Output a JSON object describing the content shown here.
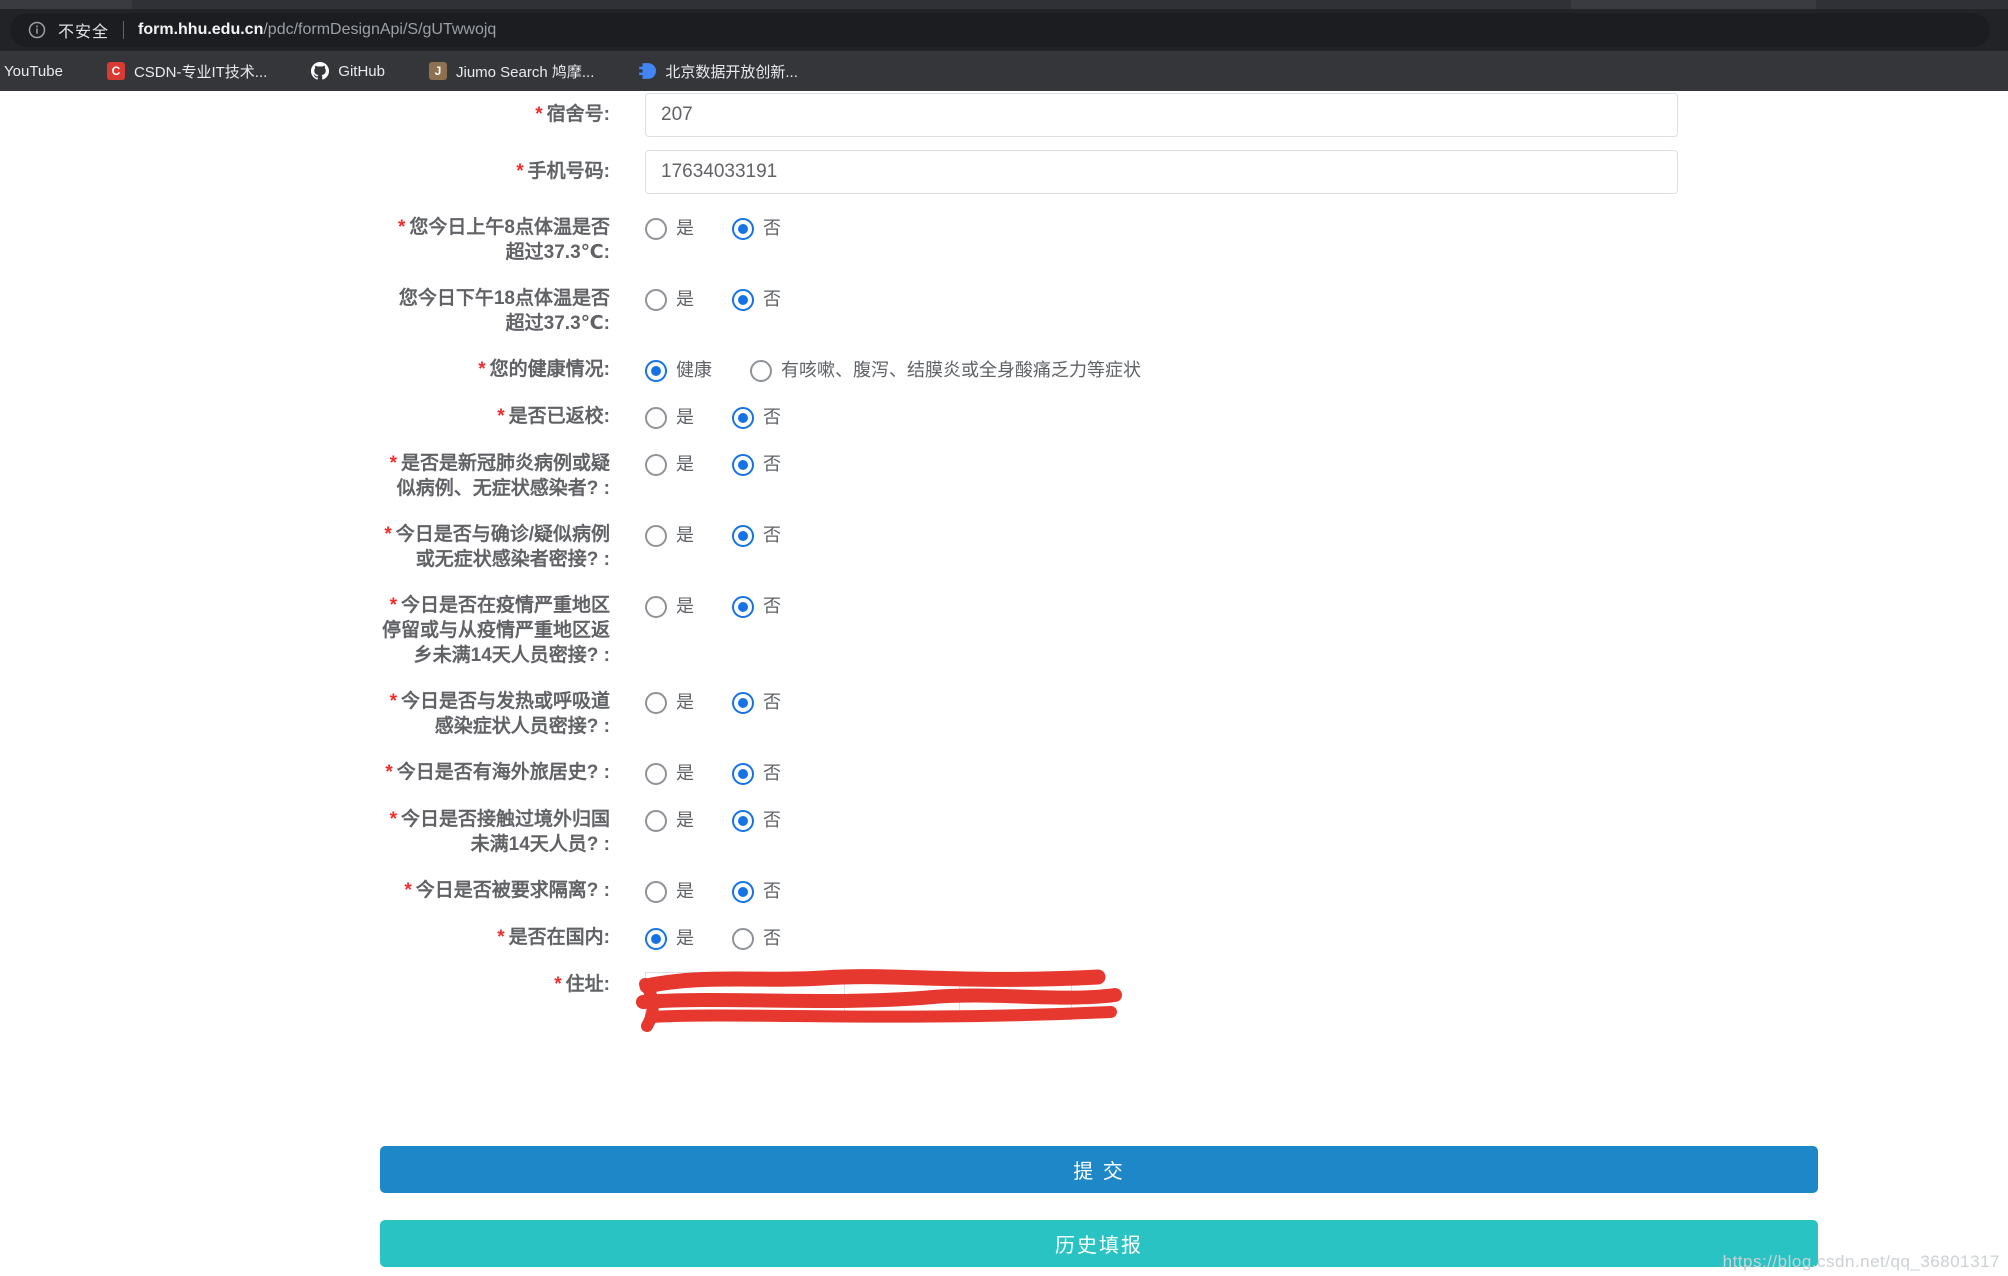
{
  "browser": {
    "security_label": "不安全",
    "url_domain": "form.hhu.edu.cn",
    "url_path": "/pdc/formDesignApi/S/gUTwwojq",
    "bookmarks": [
      {
        "label": "YouTube",
        "icon": "none"
      },
      {
        "label": "CSDN-专业IT技术...",
        "icon": "csdn-icon",
        "icon_letter": "C",
        "icon_color": "#d93a31"
      },
      {
        "label": "GitHub",
        "icon": "github-icon"
      },
      {
        "label": "Jiumo Search 鸠摩...",
        "icon": "jiumo-icon",
        "icon_letter": "J",
        "icon_color": "#8d7150"
      },
      {
        "label": "北京数据开放创新...",
        "icon": "beijing-data-icon",
        "icon_color": "#4285f4"
      }
    ]
  },
  "form": {
    "required_marker": "*",
    "fields": [
      {
        "type": "text",
        "required": true,
        "label": "宿舍号:",
        "value": "207"
      },
      {
        "type": "text",
        "required": true,
        "label": "手机号码:",
        "value": "17634033191"
      },
      {
        "type": "radio",
        "required": true,
        "label": "您今日上午8点体温是否超过37.3℃:",
        "options": [
          "是",
          "否"
        ],
        "selected": "否"
      },
      {
        "type": "radio",
        "required": false,
        "label": "您今日下午18点体温是否超过37.3℃:",
        "options": [
          "是",
          "否"
        ],
        "selected": "否"
      },
      {
        "type": "radio",
        "required": true,
        "label": "您的健康情况:",
        "options": [
          "健康",
          "有咳嗽、腹泻、结膜炎或全身酸痛乏力等症状"
        ],
        "selected": "健康"
      },
      {
        "type": "radio",
        "required": true,
        "label": "是否已返校:",
        "options": [
          "是",
          "否"
        ],
        "selected": "否"
      },
      {
        "type": "radio",
        "required": true,
        "label": "是否是新冠肺炎病例或疑似病例、无症状感染者? :",
        "options": [
          "是",
          "否"
        ],
        "selected": "否"
      },
      {
        "type": "radio",
        "required": true,
        "label": "今日是否与确诊/疑似病例或无症状感染者密接? :",
        "options": [
          "是",
          "否"
        ],
        "selected": "否"
      },
      {
        "type": "radio",
        "required": true,
        "label": "今日是否在疫情严重地区停留或与从疫情严重地区返乡未满14天人员密接? :",
        "options": [
          "是",
          "否"
        ],
        "selected": "否"
      },
      {
        "type": "radio",
        "required": true,
        "label": "今日是否与发热或呼吸道感染症状人员密接? :",
        "options": [
          "是",
          "否"
        ],
        "selected": "否"
      },
      {
        "type": "radio",
        "required": true,
        "label": "今日是否有海外旅居史? :",
        "options": [
          "是",
          "否"
        ],
        "selected": "否"
      },
      {
        "type": "radio",
        "required": true,
        "label": "今日是否接触过境外归国未满14天人员? :",
        "options": [
          "是",
          "否"
        ],
        "selected": "否"
      },
      {
        "type": "radio",
        "required": true,
        "label": "今日是否被要求隔离? :",
        "options": [
          "是",
          "否"
        ],
        "selected": "否"
      },
      {
        "type": "radio",
        "required": true,
        "label": "是否在国内:",
        "options": [
          "是",
          "否"
        ],
        "selected": "是"
      },
      {
        "type": "address",
        "required": true,
        "label": "住址:",
        "value": "",
        "redacted": true
      }
    ]
  },
  "buttons": {
    "submit_label": "提 交",
    "history_label": "历史填报"
  },
  "watermark": "https://blog.csdn.net/qq_36801317",
  "colors": {
    "submit_button": "#1e87c8",
    "history_button": "#29c3c3",
    "radio_checked": "#1673e6",
    "required_asterisk": "#f22d2d",
    "redaction_scribble": "#e6382e"
  }
}
